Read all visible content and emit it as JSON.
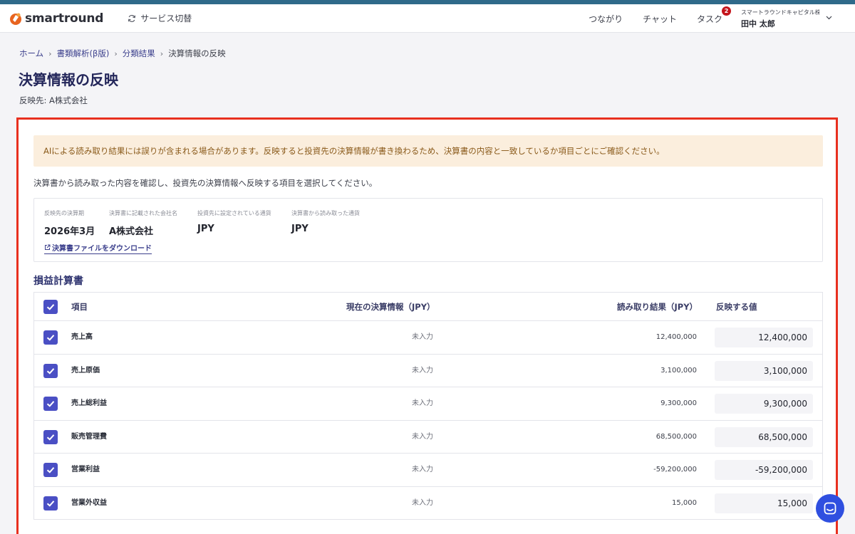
{
  "app": {
    "logo_text": "smartround",
    "service_switch_label": "サービス切替",
    "nav": [
      {
        "label": "つながり"
      },
      {
        "label": "チャット"
      },
      {
        "label": "タスク",
        "badge": "2"
      }
    ],
    "user": {
      "company": "スマートラウンドキャピタル株式…",
      "name": "田中 太郎"
    },
    "accent_color": "#4a4fc4",
    "brand_color": "#e8641f"
  },
  "breadcrumb": {
    "items": [
      "ホーム",
      "書類解析(β版)",
      "分類結果"
    ],
    "current": "決算情報の反映"
  },
  "page": {
    "title": "決算情報の反映",
    "target": "反映先: A株式会社"
  },
  "notice": {
    "warning": "AIによる読み取り結果には誤りが含まれる場合があります。反映すると投資先の決算情報が書き換わるため、決算書の内容と一致しているか項目ごとにご確認ください。",
    "instruction": "決算書から読み取った内容を確認し、投資先の決算情報へ反映する項目を選択してください。"
  },
  "info": {
    "fields": [
      {
        "label": "反映先の決算期",
        "value": "2026年3月"
      },
      {
        "label": "決算書に記載された会社名",
        "value": "A株式会社"
      },
      {
        "label": "投資先に設定されている通貨",
        "value": "JPY"
      },
      {
        "label": "決算書から読み取った通貨",
        "value": "JPY"
      }
    ],
    "download_label": "決算書ファイルをダウンロード"
  },
  "section": {
    "title": "損益計算書"
  },
  "table": {
    "headers": {
      "item": "項目",
      "current": "現在の決算情報（JPY）",
      "read": "読み取り結果（JPY）",
      "reflect": "反映する値"
    },
    "rows": [
      {
        "item": "売上高",
        "current": "未入力",
        "read": "12,400,000",
        "reflect": "12,400,000",
        "checked": true
      },
      {
        "item": "売上原価",
        "current": "未入力",
        "read": "3,100,000",
        "reflect": "3,100,000",
        "checked": true
      },
      {
        "item": "売上総利益",
        "current": "未入力",
        "read": "9,300,000",
        "reflect": "9,300,000",
        "checked": true
      },
      {
        "item": "販売管理費",
        "current": "未入力",
        "read": "68,500,000",
        "reflect": "68,500,000",
        "checked": true
      },
      {
        "item": "営業利益",
        "current": "未入力",
        "read": "-59,200,000",
        "reflect": "-59,200,000",
        "checked": true
      },
      {
        "item": "営業外収益",
        "current": "未入力",
        "read": "15,000",
        "reflect": "15,000",
        "checked": true
      }
    ]
  }
}
